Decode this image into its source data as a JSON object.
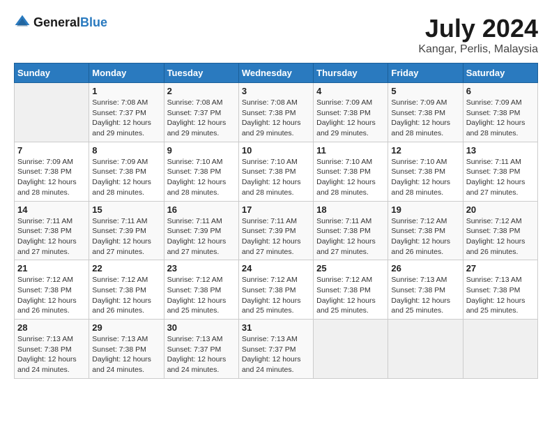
{
  "header": {
    "logo_general": "General",
    "logo_blue": "Blue",
    "month_title": "July 2024",
    "location": "Kangar, Perlis, Malaysia"
  },
  "days_of_week": [
    "Sunday",
    "Monday",
    "Tuesday",
    "Wednesday",
    "Thursday",
    "Friday",
    "Saturday"
  ],
  "weeks": [
    [
      {
        "day": "",
        "info": ""
      },
      {
        "day": "1",
        "info": "Sunrise: 7:08 AM\nSunset: 7:37 PM\nDaylight: 12 hours and 29 minutes."
      },
      {
        "day": "2",
        "info": "Sunrise: 7:08 AM\nSunset: 7:37 PM\nDaylight: 12 hours and 29 minutes."
      },
      {
        "day": "3",
        "info": "Sunrise: 7:08 AM\nSunset: 7:38 PM\nDaylight: 12 hours and 29 minutes."
      },
      {
        "day": "4",
        "info": "Sunrise: 7:09 AM\nSunset: 7:38 PM\nDaylight: 12 hours and 29 minutes."
      },
      {
        "day": "5",
        "info": "Sunrise: 7:09 AM\nSunset: 7:38 PM\nDaylight: 12 hours and 28 minutes."
      },
      {
        "day": "6",
        "info": "Sunrise: 7:09 AM\nSunset: 7:38 PM\nDaylight: 12 hours and 28 minutes."
      }
    ],
    [
      {
        "day": "7",
        "info": "Sunrise: 7:09 AM\nSunset: 7:38 PM\nDaylight: 12 hours and 28 minutes."
      },
      {
        "day": "8",
        "info": "Sunrise: 7:09 AM\nSunset: 7:38 PM\nDaylight: 12 hours and 28 minutes."
      },
      {
        "day": "9",
        "info": "Sunrise: 7:10 AM\nSunset: 7:38 PM\nDaylight: 12 hours and 28 minutes."
      },
      {
        "day": "10",
        "info": "Sunrise: 7:10 AM\nSunset: 7:38 PM\nDaylight: 12 hours and 28 minutes."
      },
      {
        "day": "11",
        "info": "Sunrise: 7:10 AM\nSunset: 7:38 PM\nDaylight: 12 hours and 28 minutes."
      },
      {
        "day": "12",
        "info": "Sunrise: 7:10 AM\nSunset: 7:38 PM\nDaylight: 12 hours and 28 minutes."
      },
      {
        "day": "13",
        "info": "Sunrise: 7:11 AM\nSunset: 7:38 PM\nDaylight: 12 hours and 27 minutes."
      }
    ],
    [
      {
        "day": "14",
        "info": "Sunrise: 7:11 AM\nSunset: 7:38 PM\nDaylight: 12 hours and 27 minutes."
      },
      {
        "day": "15",
        "info": "Sunrise: 7:11 AM\nSunset: 7:39 PM\nDaylight: 12 hours and 27 minutes."
      },
      {
        "day": "16",
        "info": "Sunrise: 7:11 AM\nSunset: 7:39 PM\nDaylight: 12 hours and 27 minutes."
      },
      {
        "day": "17",
        "info": "Sunrise: 7:11 AM\nSunset: 7:39 PM\nDaylight: 12 hours and 27 minutes."
      },
      {
        "day": "18",
        "info": "Sunrise: 7:11 AM\nSunset: 7:38 PM\nDaylight: 12 hours and 27 minutes."
      },
      {
        "day": "19",
        "info": "Sunrise: 7:12 AM\nSunset: 7:38 PM\nDaylight: 12 hours and 26 minutes."
      },
      {
        "day": "20",
        "info": "Sunrise: 7:12 AM\nSunset: 7:38 PM\nDaylight: 12 hours and 26 minutes."
      }
    ],
    [
      {
        "day": "21",
        "info": "Sunrise: 7:12 AM\nSunset: 7:38 PM\nDaylight: 12 hours and 26 minutes."
      },
      {
        "day": "22",
        "info": "Sunrise: 7:12 AM\nSunset: 7:38 PM\nDaylight: 12 hours and 26 minutes."
      },
      {
        "day": "23",
        "info": "Sunrise: 7:12 AM\nSunset: 7:38 PM\nDaylight: 12 hours and 25 minutes."
      },
      {
        "day": "24",
        "info": "Sunrise: 7:12 AM\nSunset: 7:38 PM\nDaylight: 12 hours and 25 minutes."
      },
      {
        "day": "25",
        "info": "Sunrise: 7:12 AM\nSunset: 7:38 PM\nDaylight: 12 hours and 25 minutes."
      },
      {
        "day": "26",
        "info": "Sunrise: 7:13 AM\nSunset: 7:38 PM\nDaylight: 12 hours and 25 minutes."
      },
      {
        "day": "27",
        "info": "Sunrise: 7:13 AM\nSunset: 7:38 PM\nDaylight: 12 hours and 25 minutes."
      }
    ],
    [
      {
        "day": "28",
        "info": "Sunrise: 7:13 AM\nSunset: 7:38 PM\nDaylight: 12 hours and 24 minutes."
      },
      {
        "day": "29",
        "info": "Sunrise: 7:13 AM\nSunset: 7:38 PM\nDaylight: 12 hours and 24 minutes."
      },
      {
        "day": "30",
        "info": "Sunrise: 7:13 AM\nSunset: 7:37 PM\nDaylight: 12 hours and 24 minutes."
      },
      {
        "day": "31",
        "info": "Sunrise: 7:13 AM\nSunset: 7:37 PM\nDaylight: 12 hours and 24 minutes."
      },
      {
        "day": "",
        "info": ""
      },
      {
        "day": "",
        "info": ""
      },
      {
        "day": "",
        "info": ""
      }
    ]
  ]
}
